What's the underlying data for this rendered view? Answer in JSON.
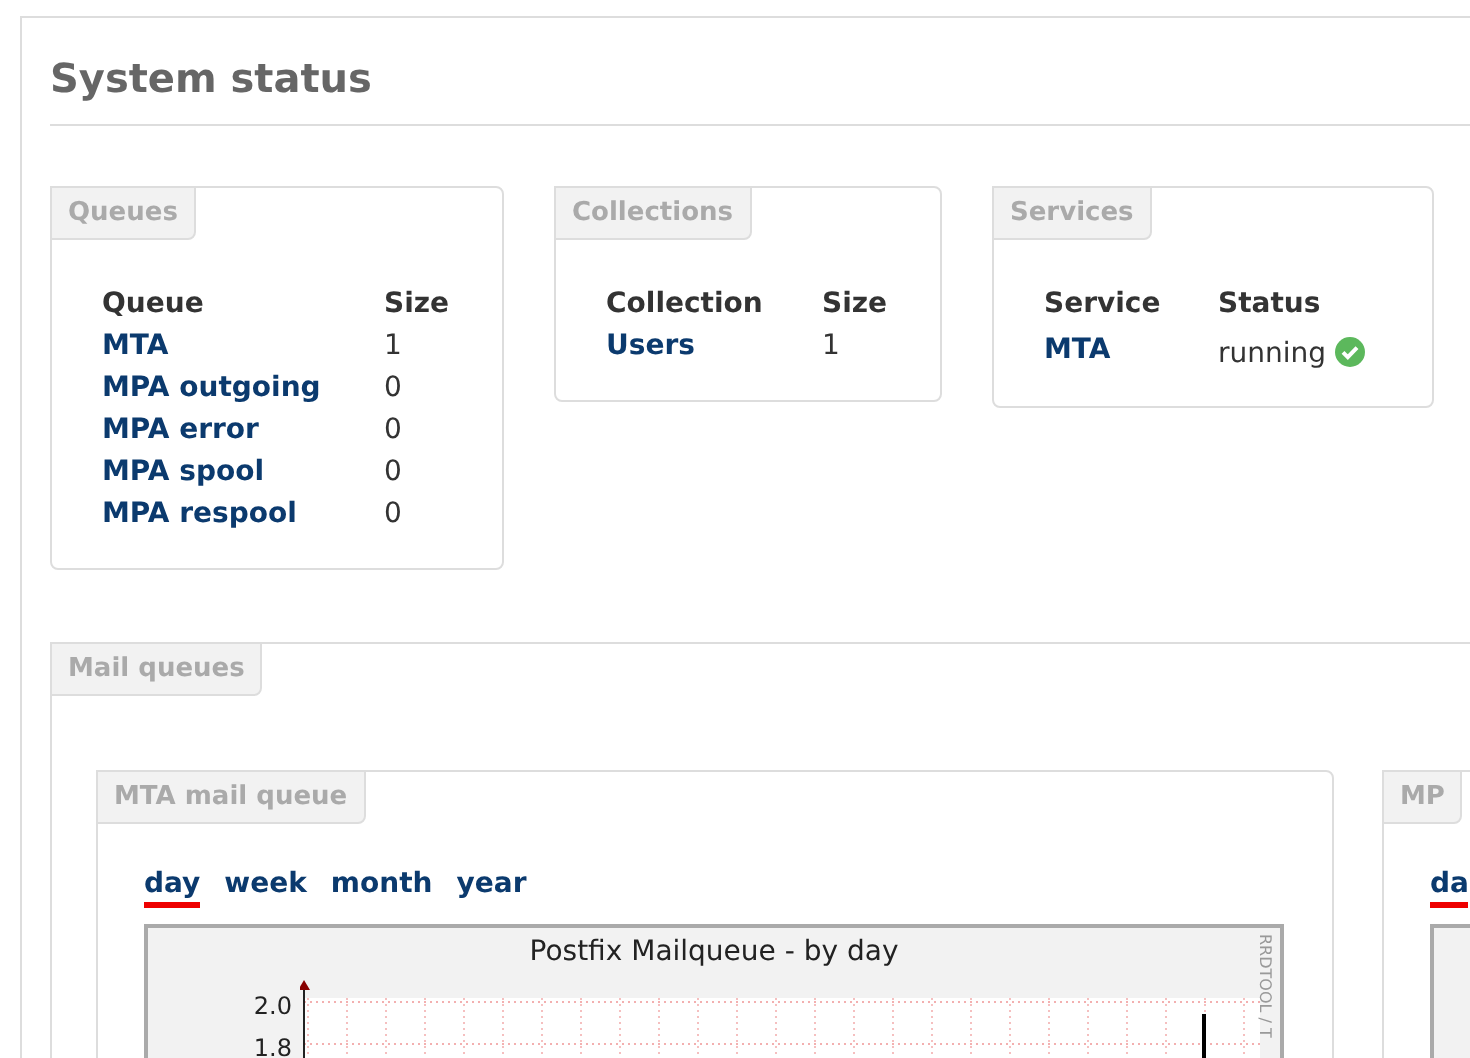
{
  "title": "System status",
  "boxes": [
    {
      "legend": "Queues",
      "columns": [
        "Queue",
        "Size"
      ],
      "rows": [
        [
          "MTA",
          "1"
        ],
        [
          "MPA outgoing",
          "0"
        ],
        [
          "MPA error",
          "0"
        ],
        [
          "MPA spool",
          "0"
        ],
        [
          "MPA respool",
          "0"
        ]
      ]
    },
    {
      "legend": "Collections",
      "columns": [
        "Collection",
        "Size"
      ],
      "rows": [
        [
          "Users",
          "1"
        ]
      ]
    },
    {
      "legend": "Services",
      "columns": [
        "Service",
        "Status"
      ],
      "rows": [
        [
          "MTA",
          "running"
        ]
      ]
    }
  ],
  "mail_queues": {
    "legend": "Mail queues",
    "panels": [
      {
        "legend": "MTA mail queue",
        "tabs": [
          {
            "label": "day",
            "selected": true
          },
          {
            "label": "week",
            "selected": false
          },
          {
            "label": "month",
            "selected": false
          },
          {
            "label": "year",
            "selected": false
          }
        ],
        "graph": {
          "title": "Postfix Mailqueue - by day",
          "side_text": "RRDTOOL / T",
          "tick_labels": [
            "2.0",
            "1.8"
          ]
        }
      },
      {
        "legend": "MP",
        "tabs": [
          {
            "label": "da",
            "selected": true
          }
        ]
      }
    ]
  }
}
